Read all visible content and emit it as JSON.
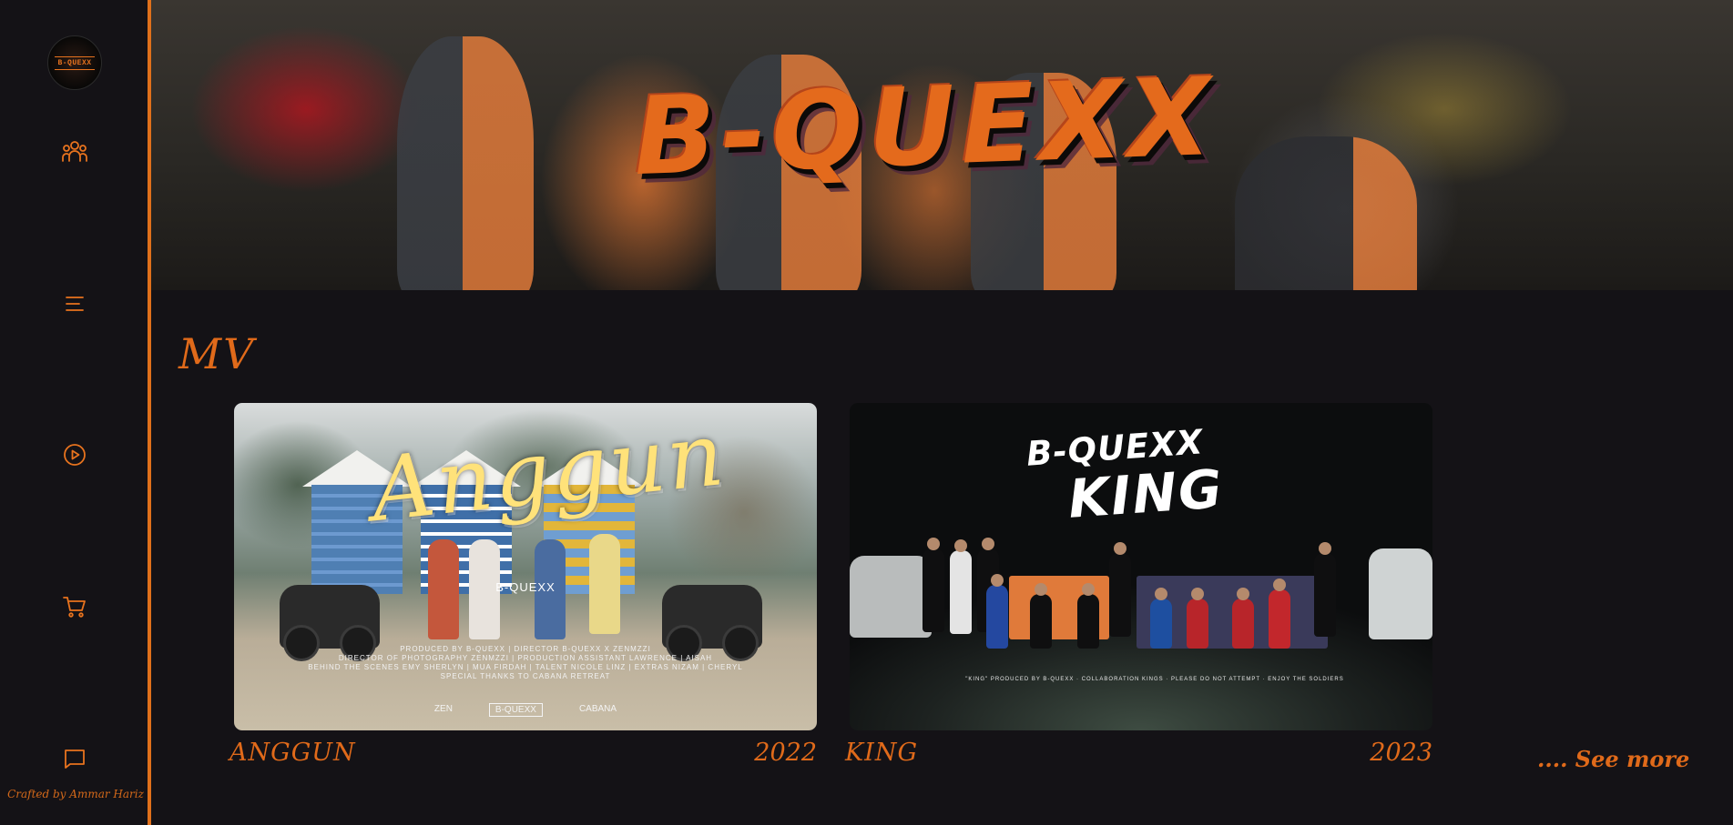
{
  "sidebar": {
    "logo_text": "B-QUEXX",
    "nav": [
      {
        "name": "members-icon"
      },
      {
        "name": "menu-icon"
      },
      {
        "name": "play-icon"
      },
      {
        "name": "cart-icon"
      },
      {
        "name": "chat-icon"
      }
    ],
    "credit": "Crafted by Ammar Hariz"
  },
  "hero": {
    "title": "B-QUEXX"
  },
  "mv_section": {
    "title": "MV",
    "see_more": ".... See more",
    "items": [
      {
        "label": "ANGGUN",
        "year": "2022",
        "thumb_title": "Anggun",
        "band_mark": "B-QUEXX",
        "credits": [
          "PRODUCED BY B-QUEXX | DIRECTOR B-QUEXX X ZENMZZI",
          "DIRECTOR OF PHOTOGRAPHY ZENMZZI | PRODUCTION ASSISTANT LAWRENCE | AISAH",
          "BEHIND THE SCENES EMY SHERLYN | MUA FIRDAH | TALENT NICOLE LINZ | EXTRAS NIZAM | CHERYL",
          "SPECIAL THANKS TO CABANA RETREAT"
        ],
        "logos": [
          "ZEN",
          "B-QUEXX",
          "CABANA"
        ]
      },
      {
        "label": "KING",
        "year": "2023",
        "thumb_brand": "B-QUEXX",
        "thumb_title": "KING",
        "caption": "\"KING\" PRODUCED BY B-QUEXX · COLLABORATION KINGS · PLEASE DO NOT ATTEMPT · ENJOY THE SOLDIERS"
      }
    ]
  },
  "colors": {
    "accent": "#e8731e",
    "background": "#141216"
  }
}
